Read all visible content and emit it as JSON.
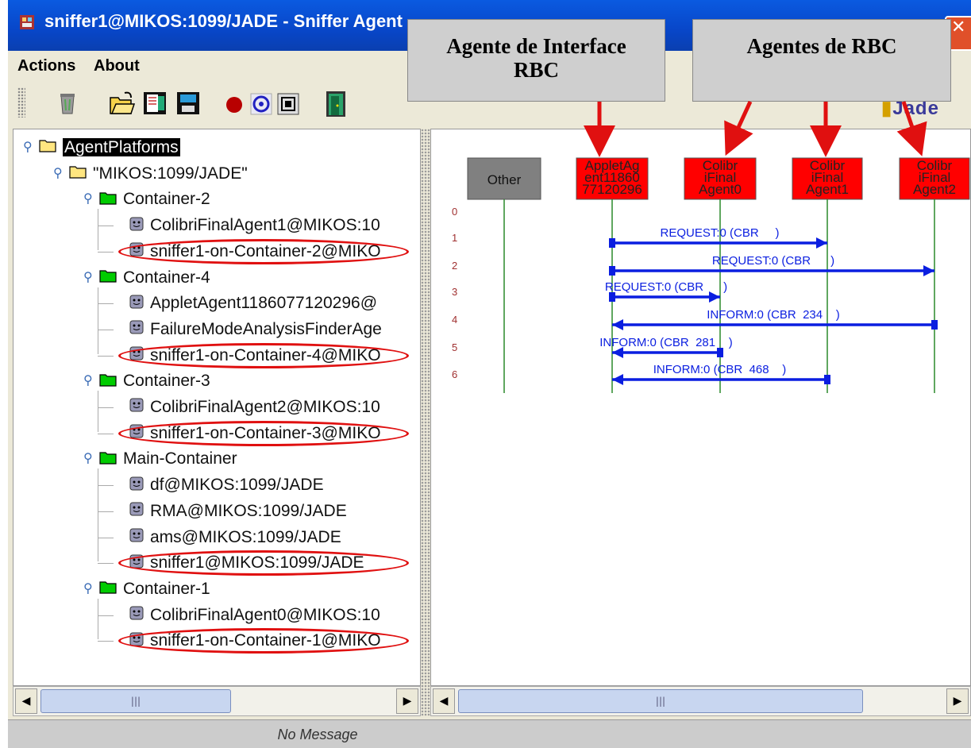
{
  "window": {
    "title": "sniffer1@MIKOS:1099/JADE - Sniffer Agent",
    "close_glyph": "✕"
  },
  "menu": {
    "items": [
      "Actions",
      "About"
    ]
  },
  "toolbar": {
    "buttons": [
      "clear-canvas-icon",
      "open-icon",
      "write-icon",
      "save-icon",
      "record-icon",
      "sniff-icon",
      "filter-icon",
      "exit-door-icon"
    ]
  },
  "logo": {
    "text": "Jade"
  },
  "tree": {
    "root": "AgentPlatforms",
    "platform": "\"MIKOS:1099/JADE\"",
    "containers": [
      {
        "name": "Container-2",
        "agents": [
          "ColibriFinalAgent1@MIKOS:10",
          "sniffer1-on-Container-2@MIKO"
        ]
      },
      {
        "name": "Container-4",
        "agents": [
          "AppletAgent1186077120296@",
          "FailureModeAnalysisFinderAge",
          "sniffer1-on-Container-4@MIKO"
        ]
      },
      {
        "name": "Container-3",
        "agents": [
          "ColibriFinalAgent2@MIKOS:10",
          "sniffer1-on-Container-3@MIKO"
        ]
      },
      {
        "name": "Main-Container",
        "agents": [
          "df@MIKOS:1099/JADE",
          "RMA@MIKOS:1099/JADE",
          "ams@MIKOS:1099/JADE",
          "sniffer1@MIKOS:1099/JADE"
        ]
      },
      {
        "name": "Container-1",
        "agents": [
          "ColibriFinalAgent0@MIKOS:10",
          "sniffer1-on-Container-1@MIKO"
        ]
      }
    ]
  },
  "diagram": {
    "agents": [
      {
        "label": "Other",
        "color": "#808080"
      },
      {
        "label": "AppletAgent1186077120296",
        "lines": [
          "AppletAg",
          "ent11860",
          "77120296"
        ],
        "color": "#ff0000"
      },
      {
        "label": "ColibriFinalAgent0",
        "lines": [
          "Colibr",
          "iFinal",
          "Agent0"
        ],
        "color": "#ff0000"
      },
      {
        "label": "ColibriFinalAgent1",
        "lines": [
          "Colibr",
          "iFinal",
          "Agent1"
        ],
        "color": "#ff0000"
      },
      {
        "label": "ColibriFinalAgent2",
        "lines": [
          "Colibr",
          "iFinal",
          "Agent2"
        ],
        "color": "#ff0000"
      }
    ],
    "row_numbers": [
      "0",
      "1",
      "2",
      "3",
      "4",
      "5",
      "6"
    ],
    "messages": [
      {
        "row": 1,
        "from": 1,
        "to": 3,
        "label": "REQUEST:0 (CBR     )"
      },
      {
        "row": 2,
        "from": 1,
        "to": 4,
        "label": "REQUEST:0 (CBR      )"
      },
      {
        "row": 3,
        "from": 1,
        "to": 2,
        "label": "REQUEST:0 (CBR      )"
      },
      {
        "row": 4,
        "from": 4,
        "to": 1,
        "label": "INFORM:0 (CBR  234    )"
      },
      {
        "row": 5,
        "from": 2,
        "to": 1,
        "label": "INFORM:0 (CBR  281    )"
      },
      {
        "row": 6,
        "from": 3,
        "to": 1,
        "label": "INFORM:0 (CBR  468    )"
      }
    ],
    "message_color": "#0a1ee0"
  },
  "callouts": {
    "interface": "Agente de Interface RBC",
    "rbc": "Agentes de RBC"
  },
  "status": {
    "message": "No Message"
  },
  "scroll": {
    "thumb_glyph": "|||"
  }
}
